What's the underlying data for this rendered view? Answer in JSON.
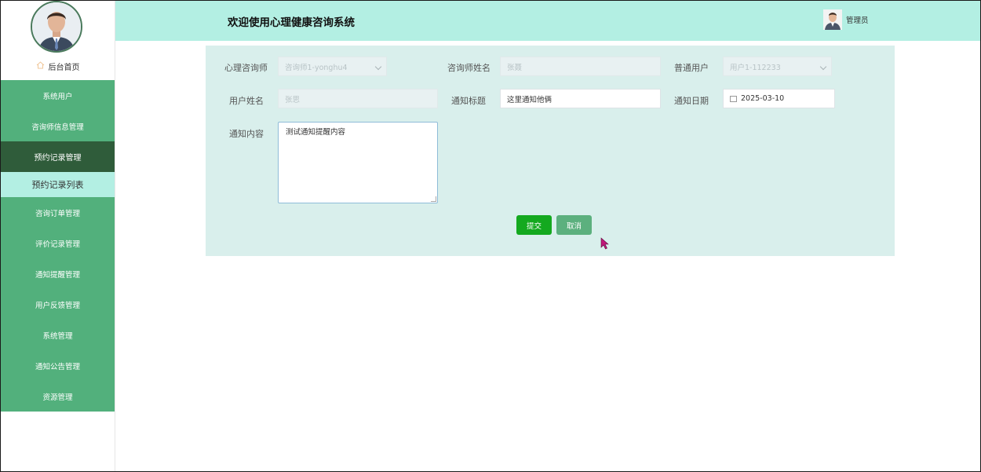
{
  "header": {
    "title": "欢迎使用心理健康咨询系统",
    "user_name": "管理员"
  },
  "sidebar": {
    "home_label": "后台首页",
    "items": [
      {
        "label": "系统用户"
      },
      {
        "label": "咨询师信息管理"
      },
      {
        "label": "预约记录管理"
      },
      {
        "label": "预约记录列表"
      },
      {
        "label": "咨询订单管理"
      },
      {
        "label": "评价记录管理"
      },
      {
        "label": "通知提醒管理"
      },
      {
        "label": "用户反馈管理"
      },
      {
        "label": "系统管理"
      },
      {
        "label": "通知公告管理"
      },
      {
        "label": "资源管理"
      }
    ]
  },
  "form": {
    "counselor_label": "心理咨询师",
    "counselor_value": "咨询师1-yonghu4",
    "counselor_name_label": "咨询师姓名",
    "counselor_name_value": "张聂",
    "user_label": "普通用户",
    "user_value": "用户1-112233",
    "user_name_label": "用户姓名",
    "user_name_value": "张思",
    "notice_title_label": "通知标题",
    "notice_title_value": "这里通知他俩",
    "notice_date_label": "通知日期",
    "notice_date_value": "2025-03-10",
    "notice_content_label": "通知内容",
    "notice_content_value": "测试通知提醒内容",
    "submit_label": "提交",
    "cancel_label": "取消"
  },
  "colors": {
    "header_bg": "#b3efe3",
    "menu_bg": "#52b07c",
    "menu_active": "#2f5c3a",
    "submit": "#14a91f",
    "cancel": "#5cb07e"
  }
}
